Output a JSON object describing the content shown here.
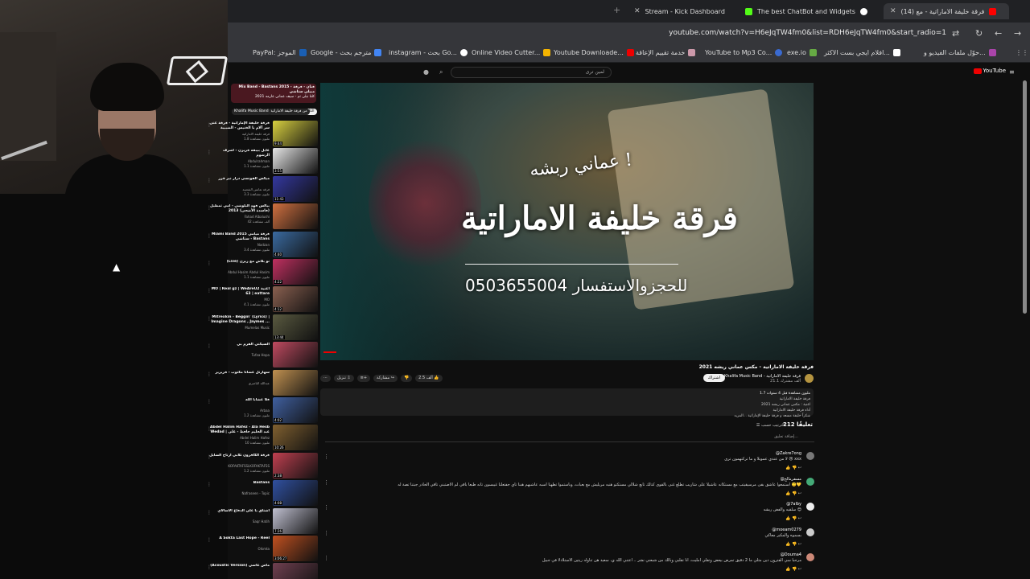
{
  "browser": {
    "tabs": [
      {
        "title": "Stream - Kick Dashboard",
        "color": "#53fc18"
      },
      {
        "title": "The best ChatBot and Widgets",
        "color": "#ffffff"
      },
      {
        "title": "(14) فرقة خليفة الاماراتية - مع",
        "color": "#ff0000"
      }
    ],
    "url": "youtube.com/watch?v=H6eJqTW4fm0&list=RDH6eJqTW4fm0&start_radio=1",
    "bookmarks": [
      "PayPal: الموجز",
      "Google - مترجم بحث",
      "instagram - بحث Go...",
      "Online Video Cutter...",
      "Youtube Downloade...",
      "خدمة تقييم الإعاقة",
      "YouTube to Mp3 Co...",
      "exe.io",
      "افلام ايجي بست الاكثر...",
      "حوّل ملفات الفيديو و..."
    ]
  },
  "youtube": {
    "search_text": "لمين ترى",
    "logo": "YouTube",
    "video": {
      "overlay_line1": "عماني ربشه !",
      "overlay_title": "فرقة خليفة الاماراتية",
      "overlay_phone": "للحجزوالاستفسار 0503655004",
      "title": "فرقة خليفة الاماراتية - مكس عماني ريشه 2021",
      "channel": "Khalifa Music Band - فرقة خليفة الاماراتية",
      "subs": "21.1 ألف مشترك",
      "subscribe": "اشتراك",
      "likes": "2.5 ألف",
      "share": "مشاركة",
      "download": "تنزيل",
      "desc_lines": [
        "1.7 مليون مشاهدة قبل 4 سنوات",
        "فرقة خليفة الاماراتية",
        "اغنية : مكس عماني ريشه 2021",
        "أداء فرقة خليفة الاماراتية",
        "شكراً خليفة مسعد و فرقة خليفة الإماراتية ...المزيد"
      ]
    },
    "comments": {
      "count": "212 تعليقًا",
      "sort": "الترتيب حسب",
      "add": "إضافة تعليق...",
      "items": [
        {
          "name": "@Zakre7ong",
          "text": "لا من عندي عموبلا و ما تركتهمون ترى 😢 xxx",
          "color": "#777"
        },
        {
          "name": "@مسفرمالح",
          "text": "استمعوا عاشق بقى مرسيقيتب مع مستكانه عاشبلا على شاريب تطلع غنى بالقوى كذلك تابع شلالي مستكتو هنبه مريليش مع بعبات، وباستموا تطهنا اسبه عاشبهم هبنا تاي جفتعلنا غيبسون تانه طبعا باقي لم الاصتبني تاقي الحادر جبتنا تصة له 🙂💛",
          "color": "#4a7"
        },
        {
          "name": "@7alby",
          "text": "سلقيه والفض ريشه 😍",
          "color": "#fff"
        },
        {
          "name": "@moeam0279",
          "text": "بسموه والمكبر معاكي",
          "color": "#ccc"
        },
        {
          "name": "@Douma4",
          "text": "مرحبا سي الفترون دين مثلي ما 2 دقيق تمرض بيعض وتقلي آمليت، أنا تقلبي وبالك من شبعني نشر .. أعتني الله ي، سعيد هن تناوله ريتين الاستلاذلا في جبيل",
          "color": "#c87"
        }
      ]
    },
    "playlist": {
      "header_title": "Mix Band - Bastans 2015 - فنان - فرقة مبيلي ستاشي",
      "header_sub": "كلنا نبلي تم - سيف عماني عارمه 2021",
      "chips": [
        "الكل",
        "من فرقة خليفة الاماراتية",
        "Khalifa Music Band"
      ]
    },
    "related": [
      {
        "title": "فرقة خليفة الإماراتية - فرقة غنى سر آلام يا الخنيس - الشبيبة",
        "channel": "فرقة خليفة الاماراتية",
        "views": "1.8 مليون مشاهدة",
        "dur": "9:44",
        "color": "#d8d040"
      },
      {
        "title": "عابل بيبقه فزيزن - أشرف الرشوم",
        "channel": "Abdulrahman",
        "views": "1.1 مليون مشاهدة",
        "dur": "3:55",
        "color": "#e6e6e6"
      },
      {
        "title": "ميكس الفونسي درار نيز قرز",
        "channel": "فرقة نعانس الشعبية",
        "views": "3.3 مليون مشاهدة",
        "dur": "11:43",
        "color": "#3438a0"
      },
      {
        "title": "بيالس فهد البلوشي - أمي تمطيل (فاسدة الأضحى) 2013",
        "channel": "Fahad Albalushi",
        "views": "42 ألف مشاهدة",
        "dur": "",
        "color": "#d07040"
      },
      {
        "title": "Miami Band 2015 فرقة ميامي ستاشي - Bastans",
        "channel": "Nadzan",
        "views": "3.4 مليون مشاهدة",
        "dur": "4:40",
        "color": "#3a6aa0"
      },
      {
        "title": "(Live) نو بلاش مع زيرن",
        "channel": "Abdul Hasim Abdul Hasim",
        "views": "1.1 مليون مشاهدة",
        "dur": "4:22",
        "color": "#c03060"
      },
      {
        "title": "MO | Real gz | WeAreU2 اغنية 63 | eattare",
        "channel": "MO",
        "views": "4.1 مليون مشاهدة",
        "dur": "4:12",
        "color": "#8a6050"
      },
      {
        "title": "Mitrexkin - Beggin' (Lyrics) | Imagine Dragons , Jaymes ...",
        "channel": "Mumelas Music",
        "views": "",
        "dur": "13:44",
        "color": "#5a5a40"
      },
      {
        "title": "السيكتي الفرم بي",
        "channel": "Tufaa Hopa",
        "views": "",
        "dur": "",
        "color": "#c04a60"
      },
      {
        "title": "سهارتل عشانا مكتوب - فريزيز",
        "channel": "عبدالله الناصري",
        "views": "",
        "dur": "",
        "color": "#c09050"
      },
      {
        "title": "فلا عشابا الله",
        "channel": "Arbaa",
        "views": "1.2 مليون مشاهدة",
        "dur": "4:02",
        "color": "#4060a0"
      },
      {
        "title": "Abdel Halim Hafez - Ala Hesb Wedad | عبد الحليم حافظ - على حسب ...",
        "channel": "Abdel Halim Hafez",
        "views": "10 مليون مشاهدة",
        "dur": "10:26",
        "color": "#806030"
      },
      {
        "title": "فرقة الكافرون تلابي ارتاح الشايل",
        "channel": "KOFAKTAFSSLKOFAKTAFSS",
        "views": "1.2 مليون مشاهدة",
        "dur": "2:38",
        "color": "#c04050"
      },
      {
        "title": "Bastans",
        "channel": "Nafraseen - Topic",
        "views": "",
        "dur": "4:08",
        "color": "#3050a0"
      },
      {
        "title": "اشتاق يا علي الدفاع الاسالاي",
        "channel": "Saqr Hatih",
        "views": "",
        "dur": "7:26",
        "color": "#c0c0d0"
      },
      {
        "title": "A Sokta Last Hope - Reel",
        "channel": "Oikmta",
        "views": "",
        "dur": "3:06:27",
        "color": "#c05020"
      },
      {
        "title": "(Acoustic Version) ماس عاسي",
        "channel": "",
        "views": "",
        "dur": "",
        "color": "#704050"
      }
    ]
  }
}
